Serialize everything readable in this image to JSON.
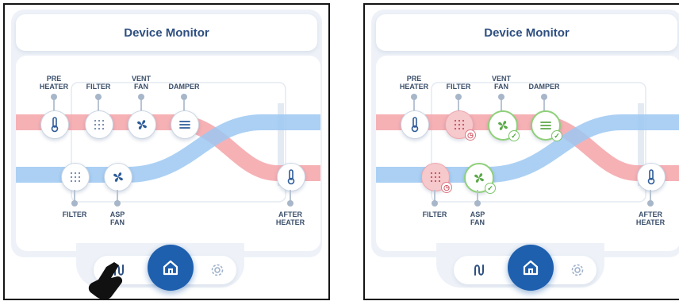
{
  "panels": [
    {
      "id": "left",
      "title": "Device Monitor",
      "labels": {
        "pre_heater": [
          "PRE",
          "HEATER"
        ],
        "filter_top": "FILTER",
        "vent_fan": [
          "VENT",
          "FAN"
        ],
        "damper": "DAMPER",
        "filter_bottom": "FILTER",
        "asp_fan": [
          "ASP",
          "FAN"
        ],
        "after_heater": [
          "AFTER",
          "HEATER"
        ]
      },
      "status": {
        "filter_top": "normal",
        "vent_fan": "normal",
        "damper": "normal",
        "filter_bottom": "normal",
        "asp_fan": "normal"
      },
      "touch_indicator": true
    },
    {
      "id": "right",
      "title": "Device Monitor",
      "labels": {
        "pre_heater": [
          "PRE",
          "HEATER"
        ],
        "filter_top": "FILTER",
        "vent_fan": [
          "VENT",
          "FAN"
        ],
        "damper": "DAMPER",
        "filter_bottom": "FILTER",
        "asp_fan": [
          "ASP",
          "FAN"
        ],
        "after_heater": [
          "AFTER",
          "HEATER"
        ]
      },
      "status": {
        "filter_top": "warning",
        "vent_fan": "ok",
        "damper": "ok",
        "filter_bottom": "warning",
        "asp_fan": "ok"
      },
      "touch_indicator": false
    }
  ],
  "icons": {
    "heater": "thermometer-icon",
    "filter": "filter-grid-icon",
    "fan": "fan-icon",
    "damper": "damper-lines-icon",
    "flow": "airflow-loop-icon",
    "home": "home-icon",
    "settings": "gear-icon",
    "ok_badge": "check-icon",
    "warn_badge": "clock-icon"
  },
  "colors": {
    "warm_air": "#f4a3a8",
    "cool_air": "#9cc8f2",
    "primary": "#1e5fae",
    "ok": "#7cc56a",
    "warning": "#e07a85"
  }
}
